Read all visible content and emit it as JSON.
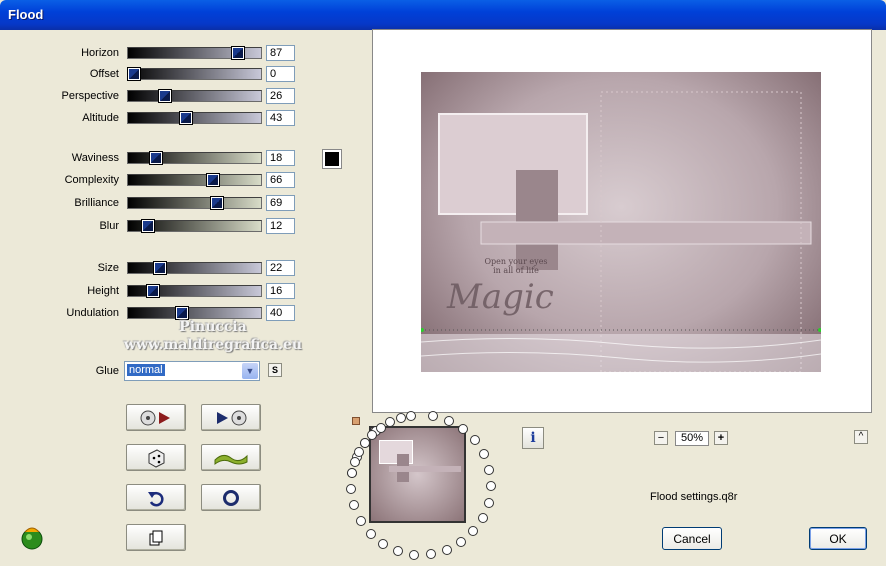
{
  "window": {
    "title": "Flood"
  },
  "sliders": [
    {
      "label": "Horizon",
      "value": "87",
      "fill": 0.87,
      "style": "gray"
    },
    {
      "label": "Offset",
      "value": "0",
      "fill": 0.0,
      "style": "gray"
    },
    {
      "label": "Perspective",
      "value": "26",
      "fill": 0.26,
      "style": "gray"
    },
    {
      "label": "Altitude",
      "value": "43",
      "fill": 0.43,
      "style": "gray"
    },
    {
      "label": "Waviness",
      "value": "18",
      "fill": 0.18,
      "style": "green"
    },
    {
      "label": "Complexity",
      "value": "66",
      "fill": 0.66,
      "style": "green"
    },
    {
      "label": "Brilliance",
      "value": "69",
      "fill": 0.69,
      "style": "green"
    },
    {
      "label": "Blur",
      "value": "12",
      "fill": 0.12,
      "style": "green"
    },
    {
      "label": "Size",
      "value": "22",
      "fill": 0.22,
      "style": "gray"
    },
    {
      "label": "Height",
      "value": "16",
      "fill": 0.16,
      "style": "gray"
    },
    {
      "label": "Undulation",
      "value": "40",
      "fill": 0.4,
      "style": "gray"
    }
  ],
  "color_swatch": "#000000",
  "watermark": {
    "line1": "Pinuccia",
    "line2": "www.maldiregrafica.eu"
  },
  "glue": {
    "label": "Glue",
    "value": "normal",
    "s_button": "S"
  },
  "zoom": {
    "value": "50%",
    "minus": "−",
    "plus": "+"
  },
  "info_button": "i",
  "caret_button": "^",
  "settings_file": "Flood settings.q8r",
  "buttons": {
    "cancel": "Cancel",
    "ok": "OK"
  },
  "art_text": {
    "magic": "Magic",
    "open": "Open your eyes in all of life"
  },
  "colors": {
    "accent": "#0a5fe6",
    "face": "#ece9d8"
  }
}
